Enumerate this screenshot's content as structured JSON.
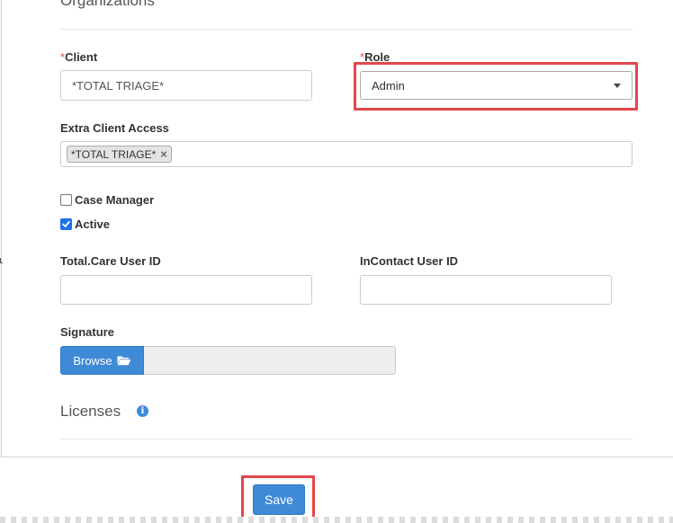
{
  "sections": {
    "organizations_title": "Organizations",
    "licenses_title": "Licenses"
  },
  "form": {
    "client": {
      "required_mark": "*",
      "label": "Client",
      "value": "*TOTAL TRIAGE*"
    },
    "role": {
      "required_mark": "*",
      "label": "Role",
      "selected": "Admin"
    },
    "extra_client_access": {
      "label": "Extra Client Access",
      "tags": [
        "*TOTAL TRIAGE*"
      ],
      "remove_glyph": "×"
    },
    "case_manager": {
      "label": "Case Manager",
      "checked": false
    },
    "active": {
      "label": "Active",
      "checked": true
    },
    "total_care_user_id": {
      "label": "Total.Care User ID",
      "value": ""
    },
    "incontact_user_id": {
      "label": "InContact User ID",
      "value": ""
    },
    "signature": {
      "label": "Signature",
      "browse_label": "Browse"
    }
  },
  "footer": {
    "save_label": "Save"
  },
  "colors": {
    "primary": "#3f8ad6",
    "highlight": "#e2474b",
    "required": "#d9534f"
  }
}
